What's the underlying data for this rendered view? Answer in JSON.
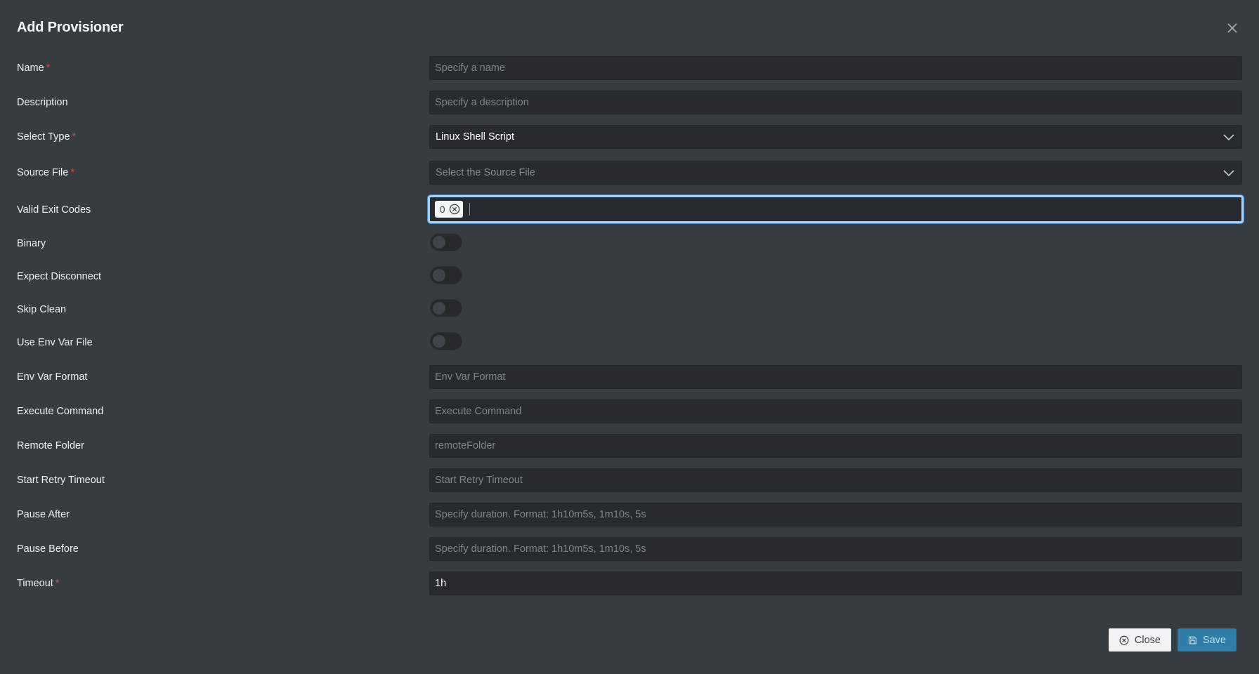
{
  "dialog": {
    "title": "Add Provisioner",
    "close_icon": "close-icon"
  },
  "fields": {
    "name": {
      "label": "Name",
      "required_mark": "*",
      "placeholder": "Specify a name",
      "value": ""
    },
    "description": {
      "label": "Description",
      "placeholder": "Specify a description",
      "value": ""
    },
    "select_type": {
      "label": "Select Type",
      "required_mark": "*",
      "value": "Linux Shell Script"
    },
    "source_file": {
      "label": "Source File",
      "required_mark": "*",
      "placeholder": "Select the Source File"
    },
    "valid_exit_codes": {
      "label": "Valid Exit Codes",
      "chips": [
        "0"
      ]
    },
    "binary": {
      "label": "Binary",
      "checked": false
    },
    "expect_disconnect": {
      "label": "Expect Disconnect",
      "checked": false
    },
    "skip_clean": {
      "label": "Skip Clean",
      "checked": false
    },
    "use_env_var_file": {
      "label": "Use Env Var File",
      "checked": false
    },
    "env_var_format": {
      "label": "Env Var Format",
      "placeholder": "Env Var Format",
      "value": ""
    },
    "execute_command": {
      "label": "Execute Command",
      "placeholder": "Execute Command",
      "value": ""
    },
    "remote_folder": {
      "label": "Remote Folder",
      "placeholder": "remoteFolder",
      "value": ""
    },
    "start_retry_timeout": {
      "label": "Start Retry Timeout",
      "placeholder": "Start Retry Timeout",
      "value": ""
    },
    "pause_after": {
      "label": "Pause After",
      "placeholder": "Specify duration. Format: 1h10m5s, 1m10s, 5s",
      "value": ""
    },
    "pause_before": {
      "label": "Pause Before",
      "placeholder": "Specify duration. Format: 1h10m5s, 1m10s, 5s",
      "value": ""
    },
    "timeout": {
      "label": "Timeout",
      "required_mark": "*",
      "value": "1h"
    }
  },
  "footer": {
    "close_label": "Close",
    "save_label": "Save",
    "close_icon": "circle-x-icon",
    "save_icon": "floppy-disk-icon"
  },
  "colors": {
    "background": "#363c40",
    "input_background": "#272b2f",
    "required": "#e0425a",
    "focus_ring": "#9fd3ff",
    "primary_button": "#2f7fa8"
  }
}
